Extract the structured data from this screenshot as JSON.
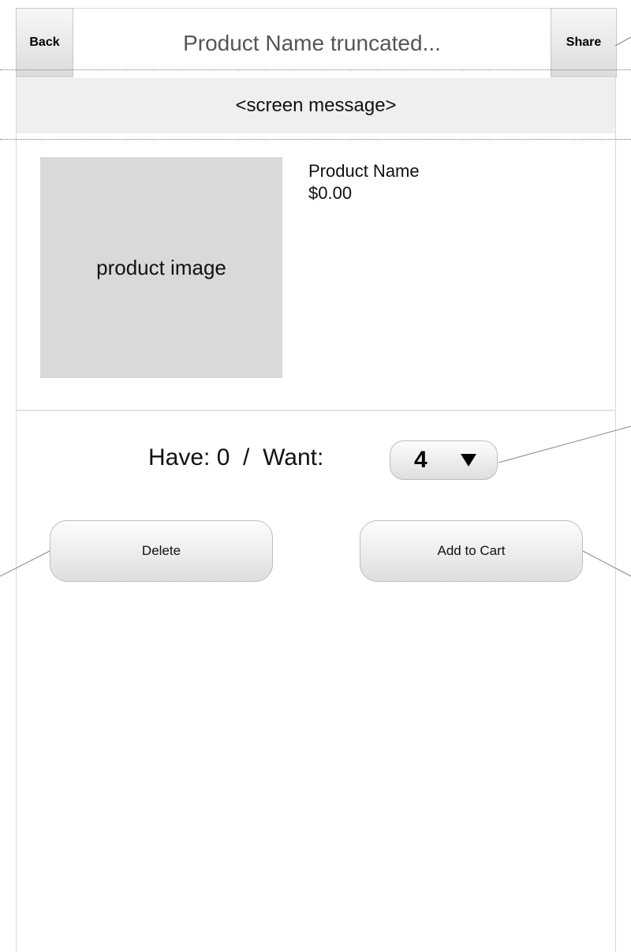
{
  "navbar": {
    "back_label": "Back",
    "title": "Product Name truncated...",
    "share_label": "Share"
  },
  "screen_message": "<screen message>",
  "product": {
    "image_placeholder": "product image",
    "name": "Product Name",
    "price": "$0.00"
  },
  "quantity": {
    "have_want_text": "Have: 0  /  Want:",
    "want_value": "4"
  },
  "actions": {
    "delete_label": "Delete",
    "add_to_cart_label": "Add to Cart"
  }
}
